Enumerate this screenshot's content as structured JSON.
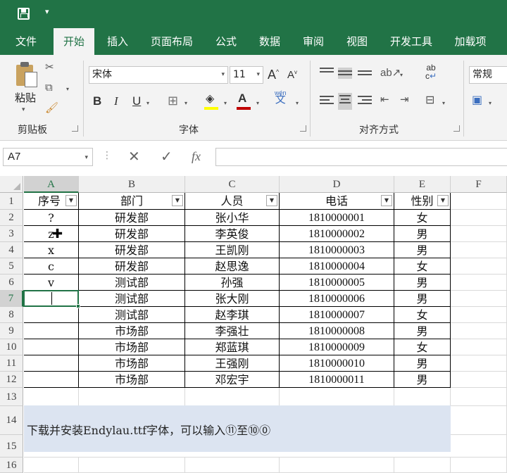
{
  "ribbon_tabs": [
    "文件",
    "开始",
    "插入",
    "页面布局",
    "公式",
    "数据",
    "审阅",
    "视图",
    "开发工具",
    "加载项"
  ],
  "active_tab": "开始",
  "clipboard": {
    "paste_label": "粘贴",
    "group_label": "剪贴板"
  },
  "font": {
    "name": "宋体",
    "size": "11",
    "group_label": "字体",
    "grow": "A",
    "shrink": "A",
    "bold": "B",
    "italic": "I",
    "underline": "U",
    "phonetic_top": "wén",
    "phonetic_bottom": "文"
  },
  "alignment": {
    "group_label": "对齐方式",
    "wrap_top": "ab",
    "wrap_bottom": "c"
  },
  "number": {
    "format": "常规"
  },
  "colors": {
    "accent": "#217346",
    "highlight_yellow": "#ffff00",
    "font_red": "#c00000",
    "note_band": "#dce4f1"
  },
  "formula_bar": {
    "name_box": "A7",
    "cancel": "✕",
    "enter": "✓",
    "fx": "fx",
    "value": ""
  },
  "columns": [
    "A",
    "B",
    "C",
    "D",
    "E",
    "F"
  ],
  "rows": [
    "1",
    "2",
    "3",
    "4",
    "5",
    "6",
    "7",
    "8",
    "9",
    "10",
    "11",
    "12",
    "13",
    "14",
    "15",
    "16"
  ],
  "table": {
    "headers": [
      "序号",
      "部门",
      "人员",
      "电话",
      "性别"
    ],
    "data": [
      [
        "?",
        "研发部",
        "张小华",
        "1810000001",
        "女"
      ],
      [
        "z",
        "研发部",
        "李英俊",
        "1810000002",
        "男"
      ],
      [
        "x",
        "研发部",
        "王凯刚",
        "1810000003",
        "男"
      ],
      [
        "c",
        "研发部",
        "赵思逸",
        "1810000004",
        "女"
      ],
      [
        "v",
        "测试部",
        "孙强",
        "1810000005",
        "男"
      ],
      [
        "",
        "测试部",
        "张大刚",
        "1810000006",
        "男"
      ],
      [
        "",
        "测试部",
        "赵李琪",
        "1810000007",
        "女"
      ],
      [
        "",
        "市场部",
        "李强壮",
        "1810000008",
        "男"
      ],
      [
        "",
        "市场部",
        "郑蓝琪",
        "1810000009",
        "女"
      ],
      [
        "",
        "市场部",
        "王强刚",
        "1810000010",
        "男"
      ],
      [
        "",
        "市场部",
        "邓宏宇",
        "1810000011",
        "男"
      ]
    ]
  },
  "note": "下载并安装Endylau.ttf字体，可以输入⑪至⑩⓪"
}
